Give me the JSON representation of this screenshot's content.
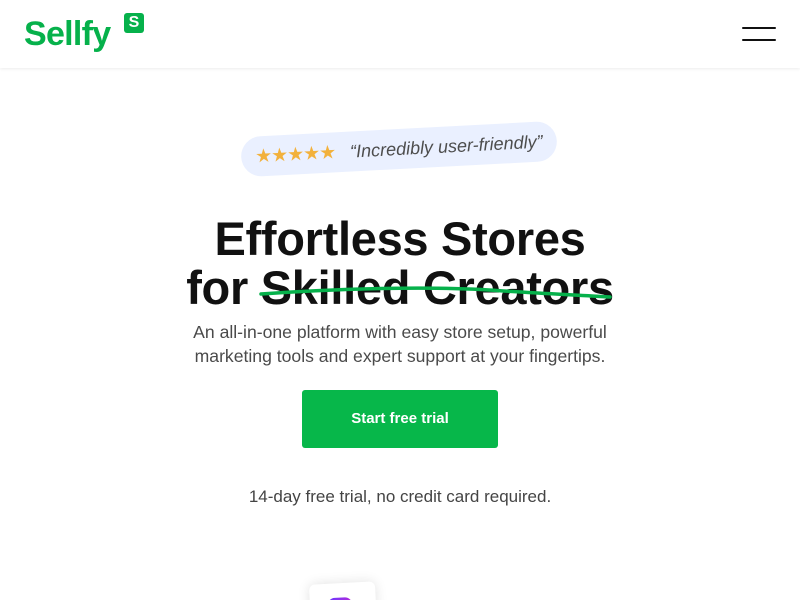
{
  "header": {
    "logo": {
      "text": "Sellfy",
      "badge": "S"
    },
    "menu_icon": "hamburger-menu-icon"
  },
  "hero": {
    "review": {
      "stars": "★★★★★",
      "quote": "“Incredibly user-friendly”"
    },
    "title_line_1": "Effortless Stores",
    "title_line_2": "for Skilled Creators",
    "subtitle": "An all-in-one platform with easy store setup, powerful marketing tools and expert support at your fingertips.",
    "cta_label": "Start free trial",
    "note": "14-day free trial, no credit card required."
  },
  "preview": {
    "icon": "instagram-icon"
  },
  "colors": {
    "brand": "#06b14b",
    "cta": "#07b74a",
    "stars": "#f2b13c",
    "review_background": "#eaf0ff",
    "headline": "#111111",
    "body_text": "#4a4a4a",
    "instagram": "#a722c8"
  }
}
